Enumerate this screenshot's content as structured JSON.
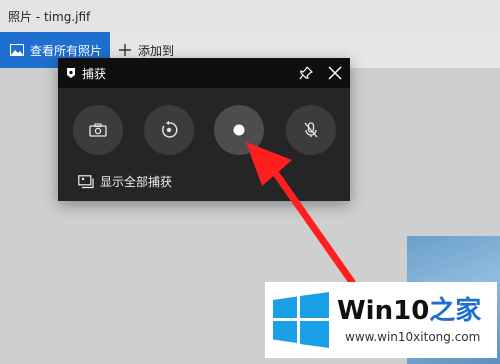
{
  "window": {
    "title": "照片 - timg.jfif"
  },
  "toolbar": {
    "view_all_label": "查看所有照片",
    "add_label": "添加到"
  },
  "capture_panel": {
    "title": "捕获",
    "show_all_label": "显示全部捕获",
    "buttons": [
      "screenshot",
      "record-last-30s",
      "start-recording",
      "mic-toggle"
    ]
  },
  "watermark": {
    "brand_prefix": "Win10",
    "brand_suffix": "之家",
    "site": "www.win10xitong.com"
  },
  "colors": {
    "accent": "#1e6fcf",
    "panel_bg": "#252525",
    "panel_head": "#0f0f0f",
    "arrow": "#ff1f1f"
  }
}
